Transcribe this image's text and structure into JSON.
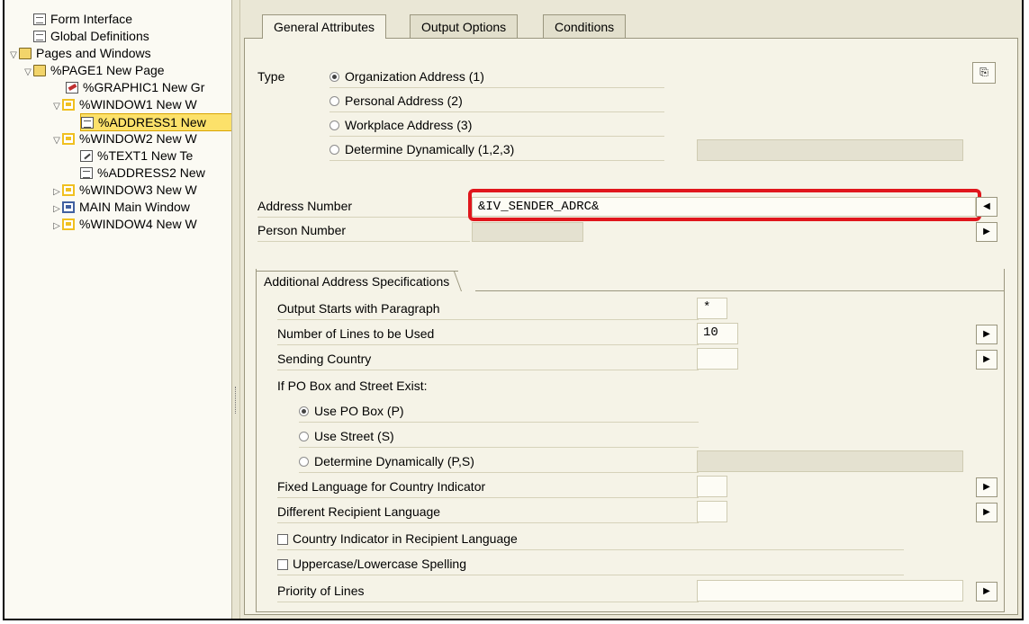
{
  "tree": {
    "items": [
      {
        "label": "Form Interface"
      },
      {
        "label": "Global Definitions"
      },
      {
        "label": "Pages and Windows"
      },
      {
        "label": "%PAGE1 New Page"
      },
      {
        "label": "%GRAPHIC1 New Gr"
      },
      {
        "label": "%WINDOW1 New W"
      },
      {
        "label": "%ADDRESS1 New"
      },
      {
        "label": "%WINDOW2 New W"
      },
      {
        "label": "%TEXT1 New Te"
      },
      {
        "label": "%ADDRESS2 New"
      },
      {
        "label": "%WINDOW3 New W"
      },
      {
        "label": "MAIN Main Window"
      },
      {
        "label": "%WINDOW4 New W"
      }
    ]
  },
  "tabs": [
    {
      "label": "General Attributes",
      "active": true
    },
    {
      "label": "Output Options",
      "active": false
    },
    {
      "label": "Conditions",
      "active": false
    }
  ],
  "type_section": {
    "label": "Type",
    "options": [
      {
        "label": "Organization Address (1)",
        "selected": true
      },
      {
        "label": "Personal Address (2)",
        "selected": false
      },
      {
        "label": "Workplace Address (3)",
        "selected": false
      },
      {
        "label": "Determine Dynamically (1,2,3)",
        "selected": false
      }
    ]
  },
  "address_number": {
    "label": "Address Number",
    "value": "&IV_SENDER_ADRC&"
  },
  "person_number": {
    "label": "Person Number",
    "value": ""
  },
  "additional": {
    "title": "Additional Address Specifications",
    "output_starts_label": "Output Starts with Paragraph",
    "output_starts_value": "*",
    "lines_label": "Number of Lines to be Used",
    "lines_value": "10",
    "sending_country_label": "Sending Country",
    "sending_country_value": "",
    "po_box_label": "If PO Box and Street Exist:",
    "po_options": [
      {
        "label": "Use PO Box (P)",
        "selected": true
      },
      {
        "label": "Use Street (S)",
        "selected": false
      },
      {
        "label": "Determine Dynamically (P,S)",
        "selected": false
      }
    ],
    "fixed_lang_label": "Fixed Language for Country Indicator",
    "diff_lang_label": "Different Recipient Language",
    "country_ind_label": "Country Indicator in Recipient Language",
    "uppercase_label": "Uppercase/Lowercase Spelling",
    "priority_label": "Priority of Lines"
  },
  "colors": {
    "highlight": "#e0161c",
    "selected_node": "#fce16a"
  }
}
